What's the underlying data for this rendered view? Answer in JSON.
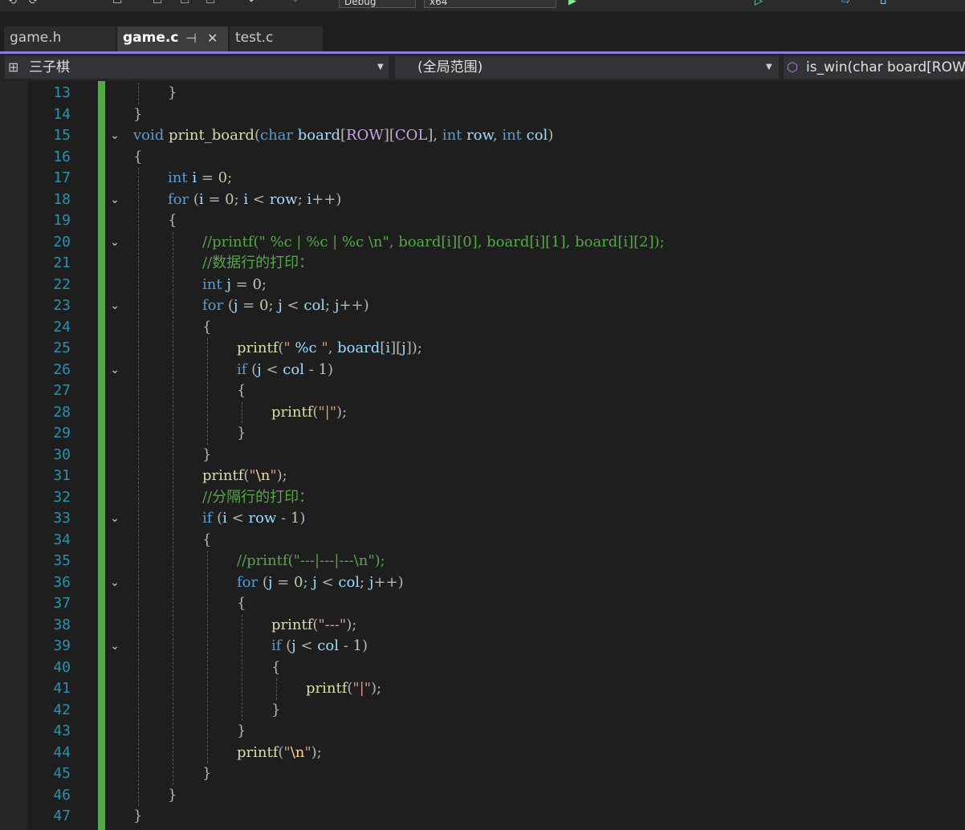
{
  "toolbar": {
    "config": "Debug",
    "platform": "x64"
  },
  "tabs": [
    {
      "label": "game.h",
      "active": false
    },
    {
      "label": "game.c",
      "active": true
    },
    {
      "label": "test.c",
      "active": false
    }
  ],
  "navbar": {
    "project": "三子棋",
    "scope": "(全局范围)",
    "member": "is_win(char board[ROW"
  },
  "colors": {
    "accent": "#8f7ae0",
    "keyword": "#569cd6",
    "function": "#dcdcaa",
    "comment": "#57a64a",
    "line_number": "#2b91af",
    "change_bar": "#57a64a"
  },
  "editor": {
    "lines": [
      {
        "num": "13",
        "fold": false,
        "indent": 1,
        "tokens": [
          [
            "p",
            "}"
          ]
        ]
      },
      {
        "num": "14",
        "fold": false,
        "indent": 0,
        "tokens": [
          [
            "p",
            "}"
          ]
        ]
      },
      {
        "num": "15",
        "fold": true,
        "indent": 0,
        "tokens": [
          [
            "k",
            "void"
          ],
          [
            "p",
            " "
          ],
          [
            "f",
            "print_board"
          ],
          [
            "p",
            "("
          ],
          [
            "k",
            "char"
          ],
          [
            "p",
            " "
          ],
          [
            "v",
            "board"
          ],
          [
            "p",
            "["
          ],
          [
            "m",
            "ROW"
          ],
          [
            "p",
            "]["
          ],
          [
            "m",
            "COL"
          ],
          [
            "p",
            "], "
          ],
          [
            "k",
            "int"
          ],
          [
            "p",
            " "
          ],
          [
            "v",
            "row"
          ],
          [
            "p",
            ", "
          ],
          [
            "k",
            "int"
          ],
          [
            "p",
            " "
          ],
          [
            "v",
            "col"
          ],
          [
            "p",
            ")"
          ]
        ]
      },
      {
        "num": "16",
        "fold": false,
        "indent": 0,
        "tokens": [
          [
            "p",
            "{"
          ]
        ]
      },
      {
        "num": "17",
        "fold": false,
        "indent": 1,
        "tokens": [
          [
            "k",
            "int"
          ],
          [
            "p",
            " "
          ],
          [
            "v",
            "i"
          ],
          [
            "p",
            " = "
          ],
          [
            "n",
            "0"
          ],
          [
            "p",
            ";"
          ]
        ]
      },
      {
        "num": "18",
        "fold": true,
        "indent": 1,
        "tokens": [
          [
            "k",
            "for"
          ],
          [
            "p",
            " ("
          ],
          [
            "v",
            "i"
          ],
          [
            "p",
            " = "
          ],
          [
            "n",
            "0"
          ],
          [
            "p",
            "; "
          ],
          [
            "v",
            "i"
          ],
          [
            "p",
            " < "
          ],
          [
            "v",
            "row"
          ],
          [
            "p",
            "; "
          ],
          [
            "v",
            "i"
          ],
          [
            "p",
            "++)"
          ]
        ]
      },
      {
        "num": "19",
        "fold": false,
        "indent": 1,
        "tokens": [
          [
            "p",
            "{"
          ]
        ]
      },
      {
        "num": "20",
        "fold": true,
        "indent": 2,
        "tokens": [
          [
            "c",
            "//printf(\" %c | %c | %c \\n\", board[i][0], board[i][1], board[i][2]);"
          ]
        ]
      },
      {
        "num": "21",
        "fold": false,
        "indent": 2,
        "tokens": [
          [
            "c",
            "//数据行的打印："
          ]
        ]
      },
      {
        "num": "22",
        "fold": false,
        "indent": 2,
        "tokens": [
          [
            "k",
            "int"
          ],
          [
            "p",
            " "
          ],
          [
            "v",
            "j"
          ],
          [
            "p",
            " = "
          ],
          [
            "n",
            "0"
          ],
          [
            "p",
            ";"
          ]
        ]
      },
      {
        "num": "23",
        "fold": true,
        "indent": 2,
        "tokens": [
          [
            "k",
            "for"
          ],
          [
            "p",
            " ("
          ],
          [
            "v",
            "j"
          ],
          [
            "p",
            " = "
          ],
          [
            "n",
            "0"
          ],
          [
            "p",
            "; "
          ],
          [
            "v",
            "j"
          ],
          [
            "p",
            " < "
          ],
          [
            "v",
            "col"
          ],
          [
            "p",
            "; "
          ],
          [
            "v",
            "j"
          ],
          [
            "p",
            "++)"
          ]
        ]
      },
      {
        "num": "24",
        "fold": false,
        "indent": 2,
        "tokens": [
          [
            "p",
            "{"
          ]
        ]
      },
      {
        "num": "25",
        "fold": false,
        "indent": 3,
        "tokens": [
          [
            "f",
            "printf"
          ],
          [
            "p",
            "("
          ],
          [
            "s",
            "\" "
          ],
          [
            "v",
            "%c"
          ],
          [
            "s",
            " \""
          ],
          [
            "p",
            ", "
          ],
          [
            "v",
            "board"
          ],
          [
            "p",
            "["
          ],
          [
            "v",
            "i"
          ],
          [
            "p",
            "]["
          ],
          [
            "v",
            "j"
          ],
          [
            "p",
            "]);"
          ]
        ]
      },
      {
        "num": "26",
        "fold": true,
        "indent": 3,
        "tokens": [
          [
            "k",
            "if"
          ],
          [
            "p",
            " ("
          ],
          [
            "v",
            "j"
          ],
          [
            "p",
            " < "
          ],
          [
            "v",
            "col"
          ],
          [
            "p",
            " - "
          ],
          [
            "n",
            "1"
          ],
          [
            "p",
            ")"
          ]
        ]
      },
      {
        "num": "27",
        "fold": false,
        "indent": 3,
        "tokens": [
          [
            "p",
            "{"
          ]
        ]
      },
      {
        "num": "28",
        "fold": false,
        "indent": 4,
        "tokens": [
          [
            "f",
            "printf"
          ],
          [
            "p",
            "("
          ],
          [
            "s",
            "\"|\""
          ],
          [
            "p",
            ");"
          ]
        ]
      },
      {
        "num": "29",
        "fold": false,
        "indent": 3,
        "tokens": [
          [
            "p",
            "}"
          ]
        ]
      },
      {
        "num": "30",
        "fold": false,
        "indent": 2,
        "tokens": [
          [
            "p",
            "}"
          ]
        ]
      },
      {
        "num": "31",
        "fold": false,
        "indent": 2,
        "tokens": [
          [
            "f",
            "printf"
          ],
          [
            "p",
            "("
          ],
          [
            "s",
            "\""
          ],
          [
            "e",
            "\\n"
          ],
          [
            "s",
            "\""
          ],
          [
            "p",
            ");"
          ]
        ]
      },
      {
        "num": "32",
        "fold": false,
        "indent": 2,
        "tokens": [
          [
            "c",
            "//分隔行的打印："
          ]
        ]
      },
      {
        "num": "33",
        "fold": true,
        "indent": 2,
        "tokens": [
          [
            "k",
            "if"
          ],
          [
            "p",
            " ("
          ],
          [
            "v",
            "i"
          ],
          [
            "p",
            " < "
          ],
          [
            "v",
            "row"
          ],
          [
            "p",
            " - "
          ],
          [
            "n",
            "1"
          ],
          [
            "p",
            ")"
          ]
        ]
      },
      {
        "num": "34",
        "fold": false,
        "indent": 2,
        "tokens": [
          [
            "p",
            "{"
          ]
        ]
      },
      {
        "num": "35",
        "fold": false,
        "indent": 3,
        "tokens": [
          [
            "c",
            "//printf(\"---|---|---\\n\");"
          ]
        ]
      },
      {
        "num": "36",
        "fold": true,
        "indent": 3,
        "tokens": [
          [
            "k",
            "for"
          ],
          [
            "p",
            " ("
          ],
          [
            "v",
            "j"
          ],
          [
            "p",
            " = "
          ],
          [
            "n",
            "0"
          ],
          [
            "p",
            "; "
          ],
          [
            "v",
            "j"
          ],
          [
            "p",
            " < "
          ],
          [
            "v",
            "col"
          ],
          [
            "p",
            "; "
          ],
          [
            "v",
            "j"
          ],
          [
            "p",
            "++)"
          ]
        ]
      },
      {
        "num": "37",
        "fold": false,
        "indent": 3,
        "tokens": [
          [
            "p",
            "{"
          ]
        ]
      },
      {
        "num": "38",
        "fold": false,
        "indent": 4,
        "tokens": [
          [
            "f",
            "printf"
          ],
          [
            "p",
            "("
          ],
          [
            "s",
            "\"---\""
          ],
          [
            "p",
            ");"
          ]
        ]
      },
      {
        "num": "39",
        "fold": true,
        "indent": 4,
        "tokens": [
          [
            "k",
            "if"
          ],
          [
            "p",
            " ("
          ],
          [
            "v",
            "j"
          ],
          [
            "p",
            " < "
          ],
          [
            "v",
            "col"
          ],
          [
            "p",
            " - "
          ],
          [
            "n",
            "1"
          ],
          [
            "p",
            ")"
          ]
        ]
      },
      {
        "num": "40",
        "fold": false,
        "indent": 4,
        "tokens": [
          [
            "p",
            "{"
          ]
        ]
      },
      {
        "num": "41",
        "fold": false,
        "indent": 5,
        "tokens": [
          [
            "f",
            "printf"
          ],
          [
            "p",
            "("
          ],
          [
            "s",
            "\"|\""
          ],
          [
            "p",
            ");"
          ]
        ]
      },
      {
        "num": "42",
        "fold": false,
        "indent": 4,
        "tokens": [
          [
            "p",
            "}"
          ]
        ]
      },
      {
        "num": "43",
        "fold": false,
        "indent": 3,
        "tokens": [
          [
            "p",
            "}"
          ]
        ]
      },
      {
        "num": "44",
        "fold": false,
        "indent": 3,
        "tokens": [
          [
            "f",
            "printf"
          ],
          [
            "p",
            "("
          ],
          [
            "s",
            "\""
          ],
          [
            "e",
            "\\n"
          ],
          [
            "s",
            "\""
          ],
          [
            "p",
            ");"
          ]
        ]
      },
      {
        "num": "45",
        "fold": false,
        "indent": 2,
        "tokens": [
          [
            "p",
            "}"
          ]
        ]
      },
      {
        "num": "46",
        "fold": false,
        "indent": 1,
        "tokens": [
          [
            "p",
            "}"
          ]
        ]
      },
      {
        "num": "47",
        "fold": false,
        "indent": 0,
        "tokens": [
          [
            "p",
            "}"
          ]
        ]
      }
    ]
  }
}
